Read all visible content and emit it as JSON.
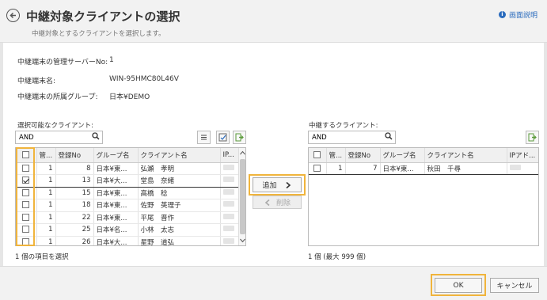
{
  "header": {
    "title": "中継対象クライアントの選択",
    "subtitle": "中継対象とするクライアントを選択します。",
    "help_label": "画面説明"
  },
  "info": {
    "server_no_label": "中継端末の管理サーバーNo:",
    "server_no_value": "1",
    "terminal_name_label": "中継端末名:",
    "terminal_name_value": "WIN-95HMC80L46V",
    "group_label": "中継端末の所属グループ:",
    "group_value": "日本¥DEMO"
  },
  "left_panel": {
    "label": "選択可能なクライアント:",
    "search_value": "AND",
    "columns": [
      "管...",
      "登録No",
      "グループ名",
      "クライアント名",
      "IP..."
    ],
    "rows": [
      {
        "checked": false,
        "kanri": "1",
        "no": "8",
        "group": "日本¥東...",
        "name": "弘瀬　孝明"
      },
      {
        "checked": true,
        "kanri": "1",
        "no": "13",
        "group": "日本¥大...",
        "name": "堂島　奈緒"
      },
      {
        "checked": false,
        "kanri": "1",
        "no": "15",
        "group": "日本¥東...",
        "name": "高橋　稔"
      },
      {
        "checked": false,
        "kanri": "1",
        "no": "18",
        "group": "日本¥東...",
        "name": "佐野　英理子"
      },
      {
        "checked": false,
        "kanri": "1",
        "no": "22",
        "group": "日本¥東...",
        "name": "平尾　晋作"
      },
      {
        "checked": false,
        "kanri": "1",
        "no": "25",
        "group": "日本¥名...",
        "name": "小林　太志"
      },
      {
        "checked": false,
        "kanri": "1",
        "no": "26",
        "group": "日本¥大...",
        "name": "星野　道弘"
      }
    ],
    "status": "1 個の項目を選択"
  },
  "middle": {
    "add_label": "追加",
    "remove_label": "削除"
  },
  "right_panel": {
    "label": "中継するクライアント:",
    "search_value": "AND",
    "columns": [
      "管...",
      "登録No",
      "グループ名",
      "クライアント名",
      "IPアド..."
    ],
    "rows": [
      {
        "checked": false,
        "kanri": "1",
        "no": "7",
        "group": "日本¥東...",
        "name": "秋田　千尋"
      }
    ],
    "status": "1 個 (最大 999 個)"
  },
  "footer": {
    "ok_label": "OK",
    "cancel_label": "キャンセル"
  },
  "colors": {
    "highlight": "#f0b43c",
    "help_link": "#2a6bbd"
  }
}
